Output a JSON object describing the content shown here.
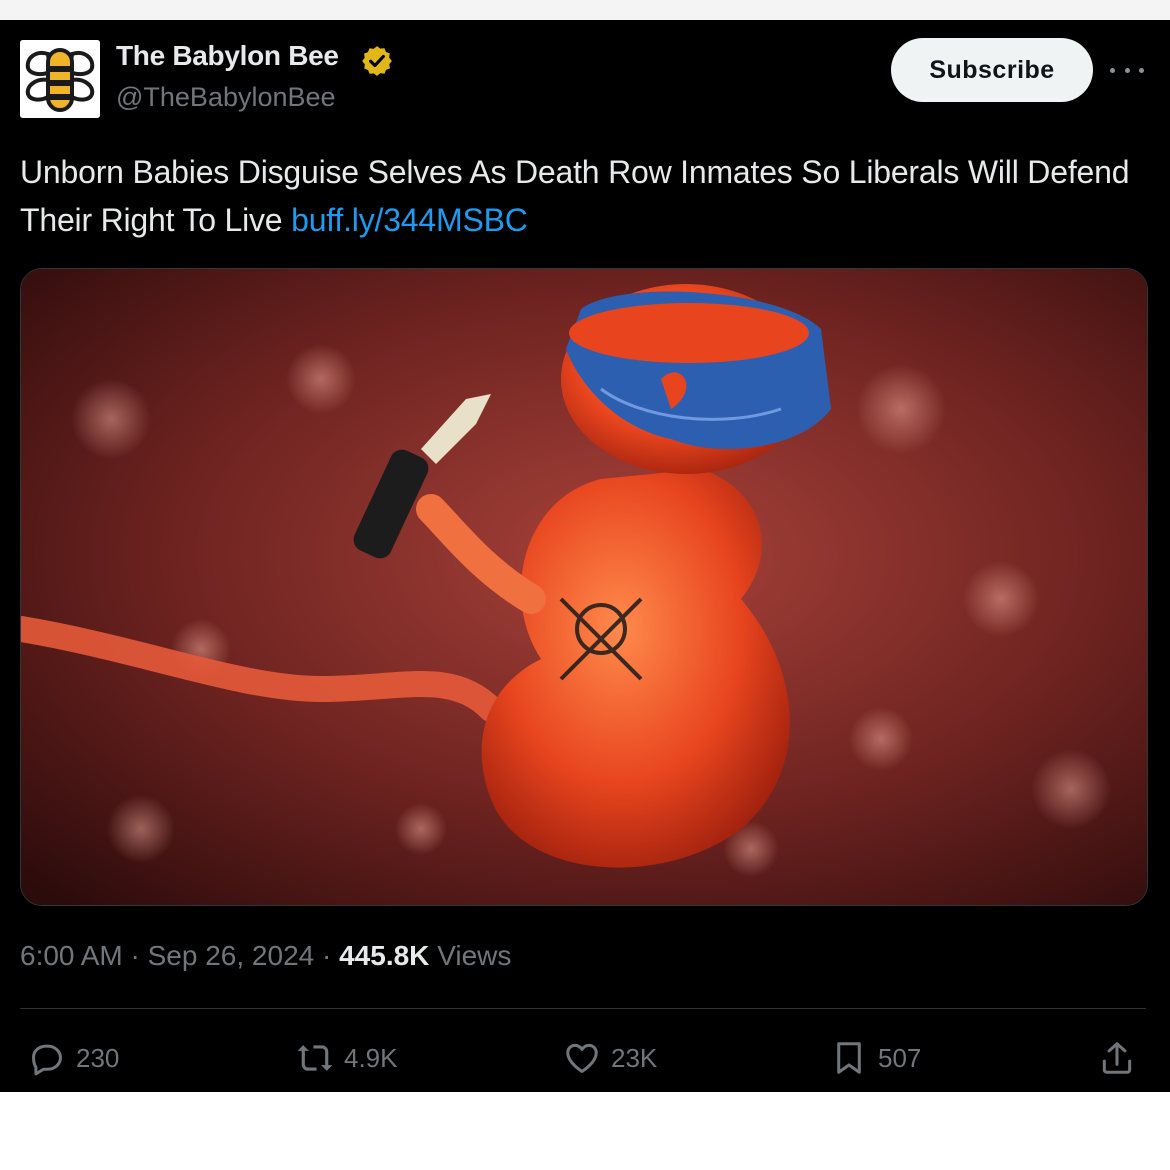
{
  "account": {
    "name": "The Babylon Bee",
    "handle": "@TheBabylonBee",
    "verified_color": "#e2b719"
  },
  "subscribe_label": "Subscribe",
  "tweet": {
    "text": "Unborn Babies Disguise Selves As Death Row Inmates So Liberals Will Defend Their Right To Live",
    "link": "buff.ly/344MSBC"
  },
  "meta": {
    "time": "6:00 AM",
    "date": "Sep 26, 2024",
    "views_count": "445.8K",
    "views_label": "Views"
  },
  "actions": {
    "replies": "230",
    "reposts": "4.9K",
    "likes": "23K",
    "bookmarks": "507"
  },
  "icons": [
    "babylon-bee-logo",
    "verified-badge-icon",
    "more-icon",
    "reply-icon",
    "repost-icon",
    "like-icon",
    "bookmark-icon",
    "share-icon"
  ],
  "colors": {
    "background": "#000000",
    "text": "#e7e9ea",
    "muted": "#71767b",
    "link": "#1d9bf0",
    "subscribe_bg": "#eff3f4"
  }
}
